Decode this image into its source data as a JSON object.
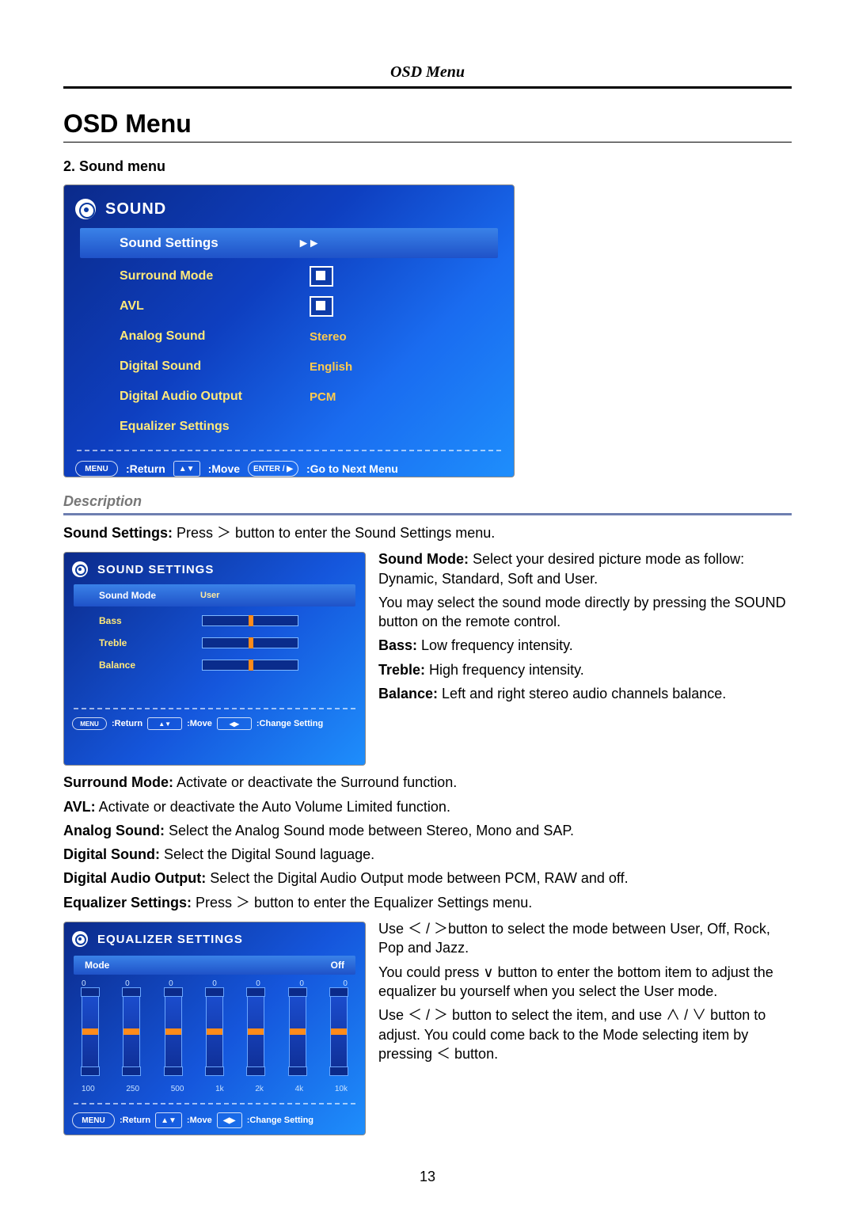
{
  "header": "OSD Menu",
  "title": "OSD Menu",
  "section_label": "2. Sound menu",
  "page_number": "13",
  "sound_shot": {
    "title": "SOUND",
    "rows": [
      {
        "label": "Sound Settings",
        "value": "▸ ▸",
        "selected": true,
        "type": "text"
      },
      {
        "label": "Surround Mode",
        "type": "check"
      },
      {
        "label": "AVL",
        "type": "check"
      },
      {
        "label": "Analog Sound",
        "value": "Stereo",
        "type": "text"
      },
      {
        "label": "Digital Sound",
        "value": "English",
        "type": "text"
      },
      {
        "label": "Digital Audio Output",
        "value": "PCM",
        "type": "text"
      },
      {
        "label": "Equalizer Settings",
        "value": "",
        "type": "text"
      }
    ],
    "footer": [
      ":Return",
      ":Move",
      ":Go to Next Menu"
    ],
    "footer_keys": [
      "MENU",
      "▲▼",
      "ENTER / ▶"
    ]
  },
  "description_label": "Description",
  "sound_settings_intro": {
    "bold": "Sound Settings:",
    "rest": "  Press  ＞  button to enter the Sound Settings menu."
  },
  "mini_sound": {
    "title": "SOUND SETTINGS",
    "rows": [
      {
        "label": "Sound Mode",
        "value": "User",
        "type": "text",
        "selected": true
      },
      {
        "label": "Bass",
        "type": "slider"
      },
      {
        "label": "Treble",
        "type": "slider"
      },
      {
        "label": "Balance",
        "type": "slider"
      }
    ],
    "footer": [
      ":Return",
      ":Move",
      ":Change Setting"
    ],
    "footer_keys": [
      "MENU",
      "▲▼",
      "◀▶"
    ]
  },
  "right_block": [
    {
      "bold": "Sound Mode:",
      "rest": " Select your desired picture mode as follow: Dynamic, Standard, Soft and User."
    },
    {
      "bold": "",
      "rest": "You may select the sound mode directly by pressing the SOUND button on the remote control."
    },
    {
      "bold": "Bass:",
      "rest": " Low frequency intensity."
    },
    {
      "bold": "Treble:",
      "rest": " High frequency intensity."
    },
    {
      "bold": "Balance:",
      "rest": " Left and right stereo audio channels balance."
    }
  ],
  "body_after": [
    {
      "bold": "Surround Mode:",
      "rest": " Activate or deactivate the Surround function."
    },
    {
      "bold": "AVL:",
      "rest": " Activate or deactivate the Auto Volume Limited function."
    },
    {
      "bold": "Analog Sound:",
      "rest": " Select the Analog Sound mode between Stereo, Mono and SAP."
    },
    {
      "bold": "Digital Sound:",
      "rest": " Select the Digital Sound laguage."
    },
    {
      "bold": "Digital Audio Output:",
      "rest": " Select the Digital Audio Output mode between PCM, RAW and off."
    },
    {
      "bold": "Equalizer Settings:",
      "rest": " Press  ＞  button to enter the Equalizer Settings menu."
    }
  ],
  "eq_shot": {
    "title": "EQUALIZER SETTINGS",
    "mode_label": "Mode",
    "mode_value": "Off",
    "zeros": [
      "0",
      "0",
      "0",
      "0",
      "0",
      "0",
      "0"
    ],
    "freqs": [
      "100",
      "250",
      "500",
      "1k",
      "2k",
      "4k",
      "10k"
    ],
    "footer": [
      ":Return",
      ":Move",
      ":Change Setting"
    ],
    "footer_keys": [
      "MENU",
      "▲▼",
      "◀▶"
    ]
  },
  "eq_right": [
    "Use ＜ / ＞button to select the mode between User, Off, Rock, Pop and Jazz.",
    "You could press  ∨ button to enter the bottom item to adjust the equalizer bu yourself when you select the User mode.",
    "Use ＜ / ＞ button to select the item, and use ∧ / ∨ button to adjust. You could come back to the Mode selecting item by pressing ＜   button."
  ]
}
